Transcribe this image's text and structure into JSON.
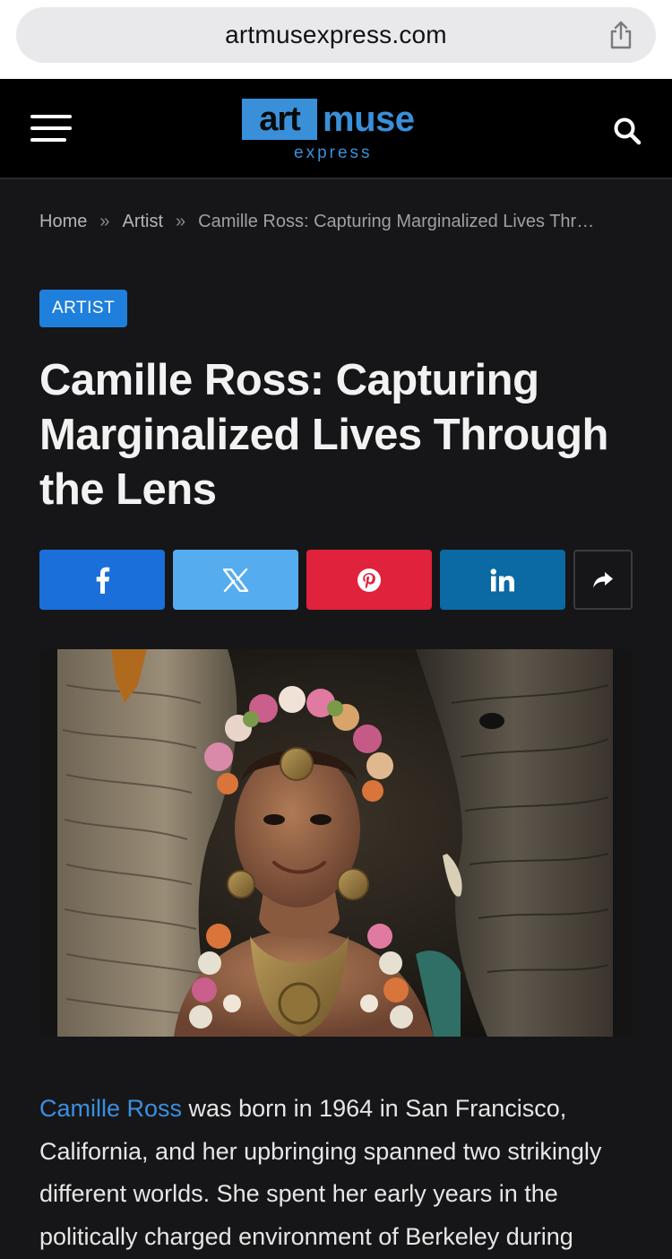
{
  "browser": {
    "url": "artmusexpress.com",
    "share_icon": "share-icon"
  },
  "header": {
    "logo": {
      "part1": "art",
      "part2": "muse",
      "part3": "express"
    },
    "menu_icon": "hamburger-icon",
    "search_icon": "search-icon"
  },
  "breadcrumb": {
    "home": "Home",
    "separator": "»",
    "category": "Artist",
    "current": "Camille Ross: Capturing Marginalized Lives Thr…"
  },
  "article": {
    "category_badge": "ARTIST",
    "title": "Camille Ross: Capturing Marginalized Lives Through the Lens",
    "share_buttons": [
      "facebook-icon",
      "x-icon",
      "pinterest-icon",
      "linkedin-icon",
      "share-arrow-icon"
    ],
    "body_link": "Camille Ross",
    "body_text": " was born in 1964 in San Francisco, California, and her upbringing spanned two strikingly different worlds. She spent her early years in the politically charged environment of Berkeley during"
  },
  "colors": {
    "accent": "#1f7fdc",
    "facebook": "#1a6fd9",
    "x": "#55acee",
    "pinterest": "#e0223c",
    "linkedin": "#0b69a3",
    "background": "#161618"
  }
}
